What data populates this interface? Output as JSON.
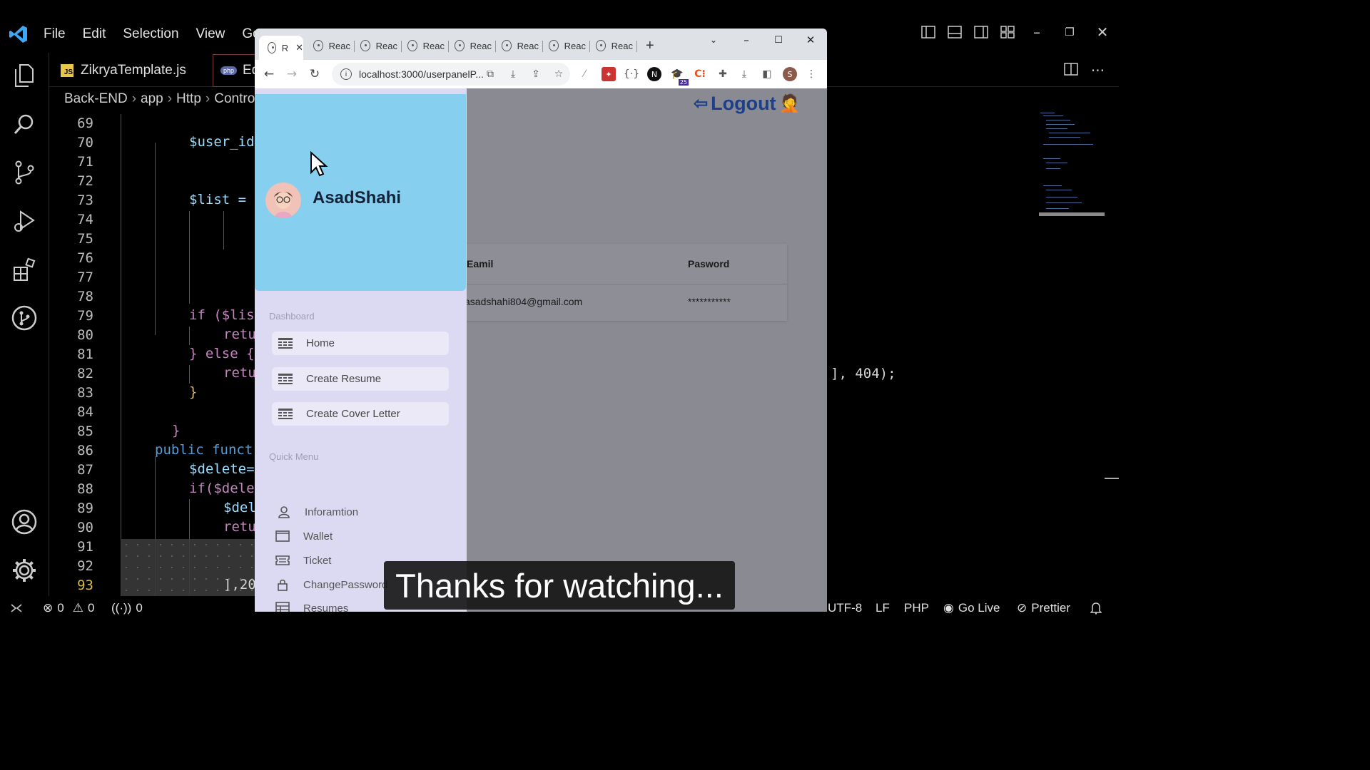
{
  "vscode": {
    "menu": [
      "File",
      "Edit",
      "Selection",
      "View",
      "Go"
    ],
    "tabs": [
      {
        "label": "ZikryaTemplate.js",
        "badge": "JS"
      },
      {
        "label": "Ed",
        "badge": "php"
      }
    ],
    "breadcrumb": [
      "Back-END",
      "app",
      "Http",
      "Contro"
    ],
    "line_numbers": [
      "69",
      "70",
      "71",
      "72",
      "73",
      "74",
      "75",
      "76",
      "77",
      "78",
      "79",
      "80",
      "81",
      "82",
      "83",
      "84",
      "85",
      "86",
      "87",
      "88",
      "89",
      "90",
      "91",
      "92",
      "93"
    ],
    "active_line": "93",
    "code": {
      "l70": "$user_id",
      "l73": "$list = ",
      "l79": "if ($lis",
      "l80": "retu",
      "l81": "} else {",
      "l82": "retu",
      "l83": "}",
      "l85": "}",
      "l86": "public funct",
      "l87": "$delete=",
      "l88": "if($dele",
      "l89": "$del",
      "l90": "retu",
      "l93": "],20",
      "l82_tail": "], 404);"
    },
    "status": {
      "errors": "0",
      "warnings": "0",
      "ports": "0",
      "encoding": "UTF-8",
      "eol": "LF",
      "language": "PHP",
      "golive": "Go Live",
      "prettier": "Prettier"
    },
    "colors": {
      "keyword": "#c586c0",
      "variable": "#9cdcfe",
      "function_kw": "#569cd6",
      "number": "#b5cea8",
      "bracket": "#d7ba7d",
      "brand": "#3ea6f2"
    }
  },
  "browser": {
    "active_tab": "R",
    "tabs": [
      "Reac",
      "Reac",
      "Reac",
      "Reac",
      "Reac",
      "Reac",
      "Reac"
    ],
    "url": "localhost:3000/userpanelP...",
    "extension_badge": "25",
    "profile_initial": "S"
  },
  "app": {
    "logout_label": "Logout",
    "table": {
      "headers": [
        "Eamil",
        "Pasword"
      ],
      "row": [
        "asadshahi804@gmail.com",
        "***********"
      ]
    },
    "drawer": {
      "username": "AsadShahi",
      "dashboard_label": "Dashboard",
      "dashboard_items": [
        "Home",
        "Create Resume",
        "Create Cover Letter"
      ],
      "quick_label": "Quick Menu",
      "quick_items": [
        {
          "label": "Inforamtion",
          "icon": "person-icon"
        },
        {
          "label": "Wallet",
          "icon": "wallet-icon"
        },
        {
          "label": "Ticket",
          "icon": "ticket-icon"
        },
        {
          "label": "ChangePassword",
          "icon": "lock-icon"
        },
        {
          "label": "Resumes",
          "icon": "resumes-icon"
        }
      ],
      "colors": {
        "header": "#87cfef",
        "background": "#dcd9f2"
      }
    }
  },
  "subtitle": "Thanks for watching..."
}
